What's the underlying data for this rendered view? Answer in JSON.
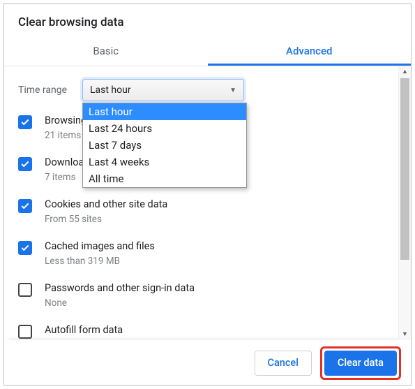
{
  "dialog": {
    "title": "Clear browsing data",
    "tabs": {
      "basic": "Basic",
      "advanced": "Advanced",
      "active": "advanced"
    },
    "time_range": {
      "label": "Time range",
      "selected": "Last hour",
      "options": [
        "Last hour",
        "Last 24 hours",
        "Last 7 days",
        "Last 4 weeks",
        "All time"
      ]
    },
    "items": [
      {
        "title": "Browsing history",
        "subtitle": "21 items",
        "checked": true
      },
      {
        "title": "Download history",
        "subtitle": "7 items",
        "checked": true
      },
      {
        "title": "Cookies and other site data",
        "subtitle": "From 55 sites",
        "checked": true
      },
      {
        "title": "Cached images and files",
        "subtitle": "Less than 319 MB",
        "checked": true
      },
      {
        "title": "Passwords and other sign-in data",
        "subtitle": "None",
        "checked": false
      },
      {
        "title": "Autofill form data",
        "subtitle": "",
        "checked": false
      }
    ],
    "buttons": {
      "cancel": "Cancel",
      "clear": "Clear data"
    }
  }
}
